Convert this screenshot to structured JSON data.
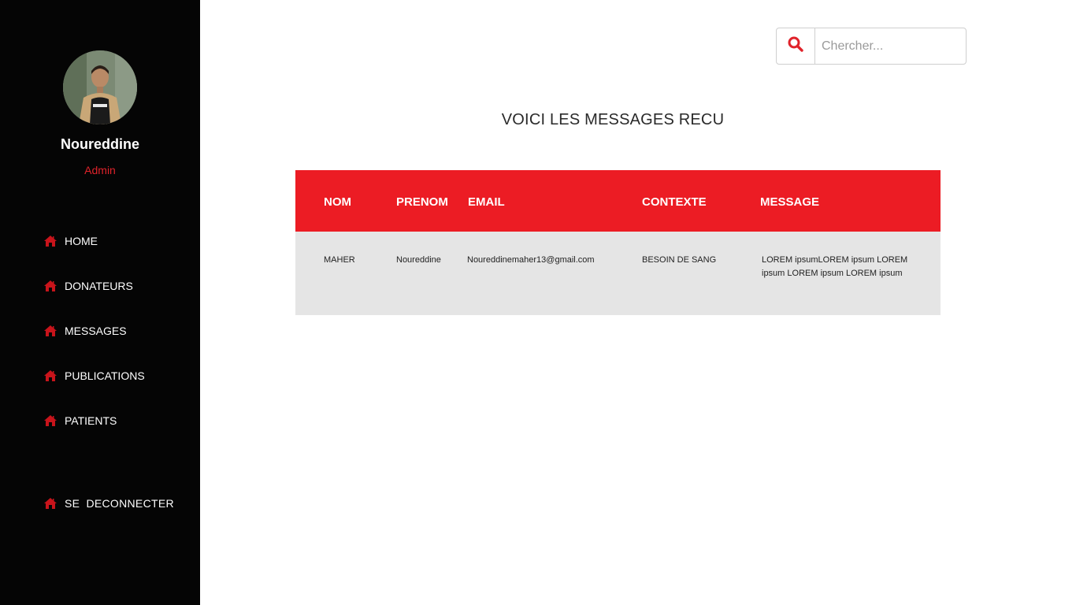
{
  "user": {
    "name": "Noureddine",
    "role": "Admin"
  },
  "nav": {
    "items": [
      {
        "label": "HOME",
        "icon": "home-icon"
      },
      {
        "label": "DONATEURS",
        "icon": "home-icon"
      },
      {
        "label": "MESSAGES",
        "icon": "home-icon"
      },
      {
        "label": "PUBLICATIONS",
        "icon": "home-icon"
      },
      {
        "label": "PATIENTS",
        "icon": "home-icon"
      }
    ],
    "logout": {
      "label": "SE DECONNECTER",
      "icon": "home-icon"
    }
  },
  "search": {
    "placeholder": "Chercher...",
    "value": "",
    "icon": "search-icon"
  },
  "main": {
    "title": "VOICI LES MESSAGES RECU"
  },
  "table": {
    "headers": [
      "NOM",
      "PRENOM",
      "EMAIL",
      "CONTEXTE",
      "MESSAGE"
    ],
    "rows": [
      [
        "MAHER",
        "Noureddine",
        "Noureddinemaher13@gmail.com",
        "BESOIN DE SANG",
        "LOREM ipsumLOREM ipsum LOREM ipsum LOREM ipsum LOREM ipsum"
      ]
    ]
  },
  "colors": {
    "accent": "#ec1c24",
    "sidebar_bg": "#050505",
    "row_bg": "#e5e5e5"
  }
}
